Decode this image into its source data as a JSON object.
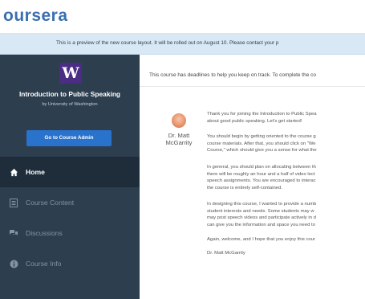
{
  "app": {
    "logo": "oursera"
  },
  "banner": {
    "text": "This is a preview of the new course layout. It will be rolled out on August 10. Please contact your p"
  },
  "sidebar": {
    "brand_letter": "W",
    "course_title": "Introduction to Public Speaking",
    "course_subtitle": "by University of Washington",
    "admin_button": "Go to Course Admin",
    "nav": [
      {
        "label": "Home",
        "icon": "home-icon"
      },
      {
        "label": "Course Content",
        "icon": "list-icon"
      },
      {
        "label": "Discussions",
        "icon": "chat-icon"
      },
      {
        "label": "Course Info",
        "icon": "info-icon"
      }
    ]
  },
  "main": {
    "deadline_text": "This course has deadlines to help you keep on track. To complete the co",
    "author": {
      "line1": "Dr. Matt",
      "line2": "McGarrity"
    },
    "paragraphs": [
      [
        "Thank you for joining the Introduction to Public Spea",
        "about good public speaking. Let's get started!"
      ],
      [
        "You should begin by getting oriented to the course g",
        "course materials. After that, you should click on \"We",
        "Course,\" which should give you a sense for what the"
      ],
      [
        "In general, you should plan on allocating between th",
        "there will be roughly an hour and a half of video lect",
        "speech assignments. You are encouraged to interac",
        "the course is entirely self-contained."
      ],
      [
        "In designing this course, I wanted to provide a numb",
        "student interests and needs. Some students may w",
        "may post speech videos and participate actively in d",
        "can give you the information and space you need to"
      ],
      [
        "Again, welcome, and I hope that you enjoy this cour"
      ],
      [
        "Dr. Matt McGarrity"
      ]
    ]
  },
  "colors": {
    "sidebar_bg": "#2d3e4f",
    "active_nav_bg": "#1f2d3b",
    "brand_purple": "#4b2e83",
    "admin_button": "#2a73cc",
    "banner_bg": "#d9e8f5",
    "logo_blue": "#3b6fb0"
  }
}
